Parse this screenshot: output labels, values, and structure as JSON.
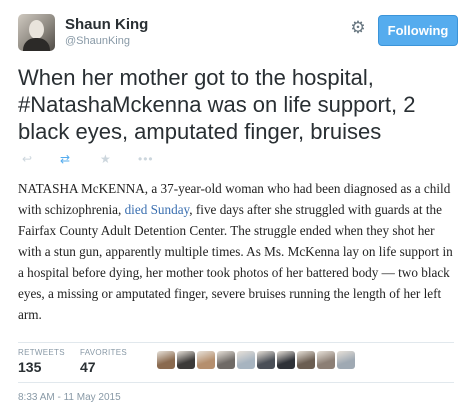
{
  "user": {
    "name": "Shaun King",
    "handle": "@ShaunKing"
  },
  "follow_button": {
    "label": "Following",
    "color": "#55acee"
  },
  "tweet": {
    "text_before": "When her mother got to the hospital, ",
    "hashtag": "#NatashaMckenna",
    "text_after": " was on life support, 2 black eyes, amputated finger, bruises"
  },
  "actions": {
    "reply_icon": "reply-icon",
    "retweet_icon": "retweet-icon",
    "favorite_icon": "star-icon",
    "more_icon": "more-icon"
  },
  "article": {
    "part1": "NATASHA McKENNA, a 37-year-old woman who had been diagnosed as a child with schizophrenia, ",
    "link": "died Sunday",
    "part2": ", five days after she struggled with guards at the Fairfax County Adult Detention Center. The struggle ended when they shot her with a stun gun, apparently multiple times. As Ms. McKenna lay on life support in a hospital before dying, her mother took photos of her battered body — two black eyes, a missing or amputated finger, severe bruises running the length of her left arm."
  },
  "stats": {
    "retweets_label": "RETWEETS",
    "retweets_count": "135",
    "favorites_label": "FAVORITES",
    "favorites_count": "47"
  },
  "favoriter_avatars": [
    "#8a6a4f",
    "#3c3a38",
    "#b58f6e",
    "#6f6a66",
    "#a7b4c0",
    "#4a4f57",
    "#2f3238",
    "#6b5e52",
    "#8c7f75",
    "#9fa9b3"
  ],
  "timestamp": "8:33 AM - 11 May 2015"
}
